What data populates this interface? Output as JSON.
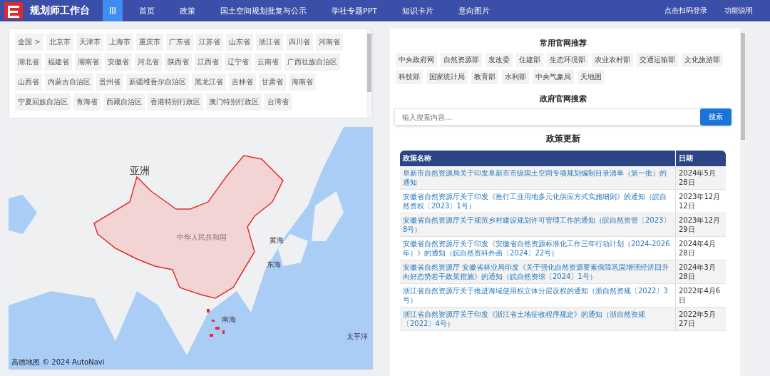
{
  "header": {
    "title": "规划师工作台",
    "nav": [
      "首页",
      "政策",
      "国土空间规划批复与公示",
      "学社专题PPT",
      "知识卡片",
      "意向图片"
    ],
    "actions": [
      "点击扫码登录",
      "功能说明"
    ]
  },
  "regions": [
    "全国 >",
    "北京市",
    "天津市",
    "上海市",
    "重庆市",
    "广东省",
    "江苏省",
    "山东省",
    "浙江省",
    "四川省",
    "河南省",
    "湖北省",
    "福建省",
    "湖南省",
    "安徽省",
    "河北省",
    "陕西省",
    "江西省",
    "辽宁省",
    "云南省",
    "广西壮族自治区",
    "山西省",
    "内蒙古自治区",
    "贵州省",
    "新疆维吾尔自治区",
    "黑龙江省",
    "吉林省",
    "甘肃省",
    "海南省",
    "宁夏回族自治区",
    "青海省",
    "西藏自治区",
    "香港特别行政区",
    "澳门特别行政区",
    "台湾省"
  ],
  "map": {
    "labels": [
      "亚洲",
      "中华人民共和国",
      "黄海",
      "东海",
      "南海",
      "太平洋"
    ],
    "attribution": "高德地图 © 2024 AutoNavi"
  },
  "sites": {
    "title": "常用官网推荐",
    "items": [
      "中央政府网",
      "自然资源部",
      "发改委",
      "住建部",
      "生态环境部",
      "农业农村部",
      "交通运输部",
      "文化旅游部",
      "科技部",
      "国家统计局",
      "教育部",
      "水利部",
      "中央气象局",
      "天地图"
    ]
  },
  "search": {
    "title": "政府官网搜索",
    "placeholder": "输入搜索内容...",
    "button": "搜索"
  },
  "policies": {
    "title": "政策更新",
    "columns": [
      "政策名称",
      "日期"
    ],
    "rows": [
      {
        "name": "阜新市自然资源局关于印发阜新市市级国土空间专项规划编制目录清单（第一批）的通知",
        "date": "2024年5月28日"
      },
      {
        "name": "安徽省自然资源厅关于印发《推行工业用地多元化供应方式实施细则》的通知（皖自然资权〔2023〕1号）",
        "date": "2023年12月12日"
      },
      {
        "name": "安徽省自然资源厅关于规范乡村建设规划许可管理工作的通知（皖自然资管〔2023〕8号）",
        "date": "2023年12月29日"
      },
      {
        "name": "安徽省自然资源厅关于印发《安徽省自然资源标准化工作三年行动计划（2024-2026年）》的通知（皖自然资科外函〔2024〕22号）",
        "date": "2024年4月28日"
      },
      {
        "name": "安徽省自然资源厅 安徽省林业局印发《关于强化自然资源要素保障巩固增强经济回升向好态势若干政策措施》的通知（皖自然资综〔2024〕1号）",
        "date": "2024年3月28日"
      },
      {
        "name": "浙江省自然资源厅关于推进海域使用权立体分层设权的通知（浙自然资规〔2022〕3号）",
        "date": "2022年4月6日"
      },
      {
        "name": "浙江省自然资源厅关于印发《浙江省土地征收程序规定》的通知（浙自然资规〔2022〕4号）",
        "date": "2022年5月27日"
      }
    ]
  }
}
